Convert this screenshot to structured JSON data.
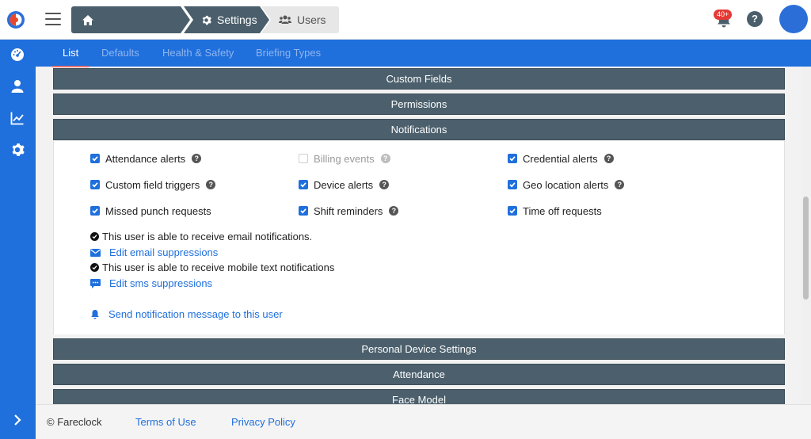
{
  "breadcrumb": {
    "settings_label": "Settings",
    "users_label": "Users"
  },
  "header": {
    "notification_badge": "40+",
    "help_label": "?"
  },
  "tabs": [
    {
      "label": "List",
      "active": true
    },
    {
      "label": "Defaults"
    },
    {
      "label": "Health & Safety"
    },
    {
      "label": "Briefing Types"
    }
  ],
  "sections": {
    "custom_fields": "Custom Fields",
    "permissions": "Permissions",
    "notifications": "Notifications",
    "personal_device_settings": "Personal Device Settings",
    "attendance": "Attendance",
    "face_model": "Face Model"
  },
  "notifications": {
    "options": [
      {
        "label": "Attendance alerts",
        "checked": true,
        "help": true
      },
      {
        "label": "Billing events",
        "checked": false,
        "disabled": true,
        "help": true
      },
      {
        "label": "Credential alerts",
        "checked": true,
        "help": true
      },
      {
        "label": "Custom field triggers",
        "checked": true,
        "help": true
      },
      {
        "label": "Device alerts",
        "checked": true,
        "help": true
      },
      {
        "label": "Geo location alerts",
        "checked": true,
        "help": true
      },
      {
        "label": "Missed punch requests",
        "checked": true,
        "help": false
      },
      {
        "label": "Shift reminders",
        "checked": true,
        "help": true
      },
      {
        "label": "Time off requests",
        "checked": true,
        "help": false
      }
    ],
    "email_status": "This user is able to receive email notifications.",
    "edit_email_link": "Edit email suppressions",
    "sms_status": "This user is able to receive mobile text notifications",
    "edit_sms_link": "Edit sms suppressions",
    "send_message_link": "Send notification message to this user"
  },
  "footer": {
    "copyright": "© Fareclock",
    "terms": "Terms of Use",
    "privacy": "Privacy Policy"
  },
  "colors": {
    "primary": "#1f6fdc",
    "section_bar": "#4b5f6c",
    "badge": "#e53935"
  }
}
